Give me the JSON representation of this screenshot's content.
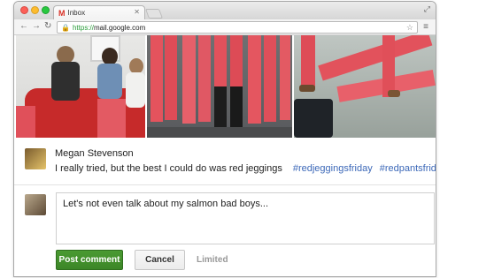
{
  "browser": {
    "tab_title": "Inbox",
    "tab_icon": "gmail-icon",
    "url_scheme": "https://",
    "url_host": "mail.google.com"
  },
  "post": {
    "author": "Megan Stevenson",
    "text": "I really tried, but the best I could do was red jeggings",
    "hashtags": [
      "#redjeggingsfriday",
      "#redpantsfriday"
    ]
  },
  "comment": {
    "value": "Let's not even talk about my salmon bad boys..."
  },
  "actions": {
    "post_label": "Post comment",
    "cancel_label": "Cancel",
    "limited_label": "Limited"
  },
  "colors": {
    "accent_green": "#3c8627",
    "hashtag_blue": "#3c68b8",
    "pants_red": "#e0505a"
  }
}
